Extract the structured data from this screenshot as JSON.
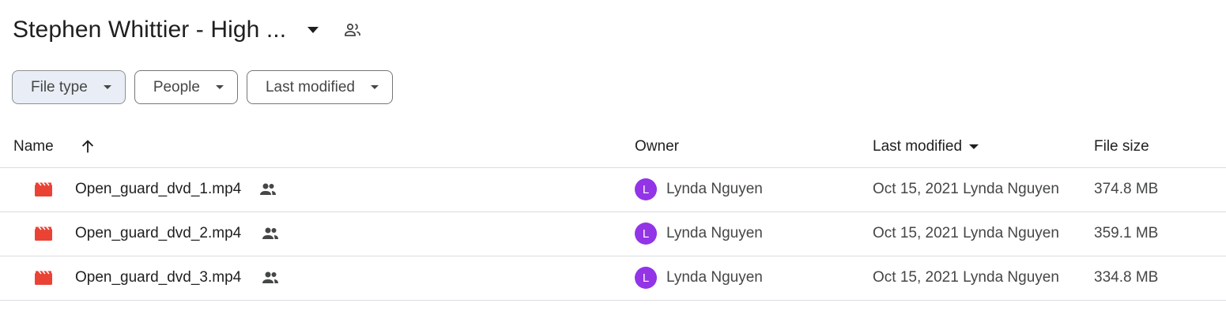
{
  "folder": {
    "title": "Stephen Whittier - High ..."
  },
  "filters": [
    {
      "label": "File type",
      "active": true
    },
    {
      "label": "People",
      "active": false
    },
    {
      "label": "Last modified",
      "active": false
    }
  ],
  "columns": {
    "name": "Name",
    "owner": "Owner",
    "last_modified": "Last modified",
    "file_size": "File size"
  },
  "sort": {
    "name_direction": "ascending",
    "last_modified_indicator": "descending"
  },
  "files": [
    {
      "name": "Open_guard_dvd_1.mp4",
      "shared": true,
      "owner_initial": "L",
      "owner": "Lynda Nguyen",
      "modified": "Oct 15, 2021 Lynda Nguyen",
      "size": "374.8 MB"
    },
    {
      "name": "Open_guard_dvd_2.mp4",
      "shared": true,
      "owner_initial": "L",
      "owner": "Lynda Nguyen",
      "modified": "Oct 15, 2021 Lynda Nguyen",
      "size": "359.1 MB"
    },
    {
      "name": "Open_guard_dvd_3.mp4",
      "shared": true,
      "owner_initial": "L",
      "owner": "Lynda Nguyen",
      "modified": "Oct 15, 2021 Lynda Nguyen",
      "size": "334.8 MB"
    }
  ],
  "icons": {
    "title_menu": "arrow-drop-down-icon",
    "shared_folder": "people-icon",
    "file": "video-file-icon",
    "shared": "people-icon",
    "sort": "arrow-upward-icon"
  },
  "colors": {
    "video_icon": "#ea4335",
    "avatar": "#9334e6",
    "active_chip": "#e9eef6"
  }
}
